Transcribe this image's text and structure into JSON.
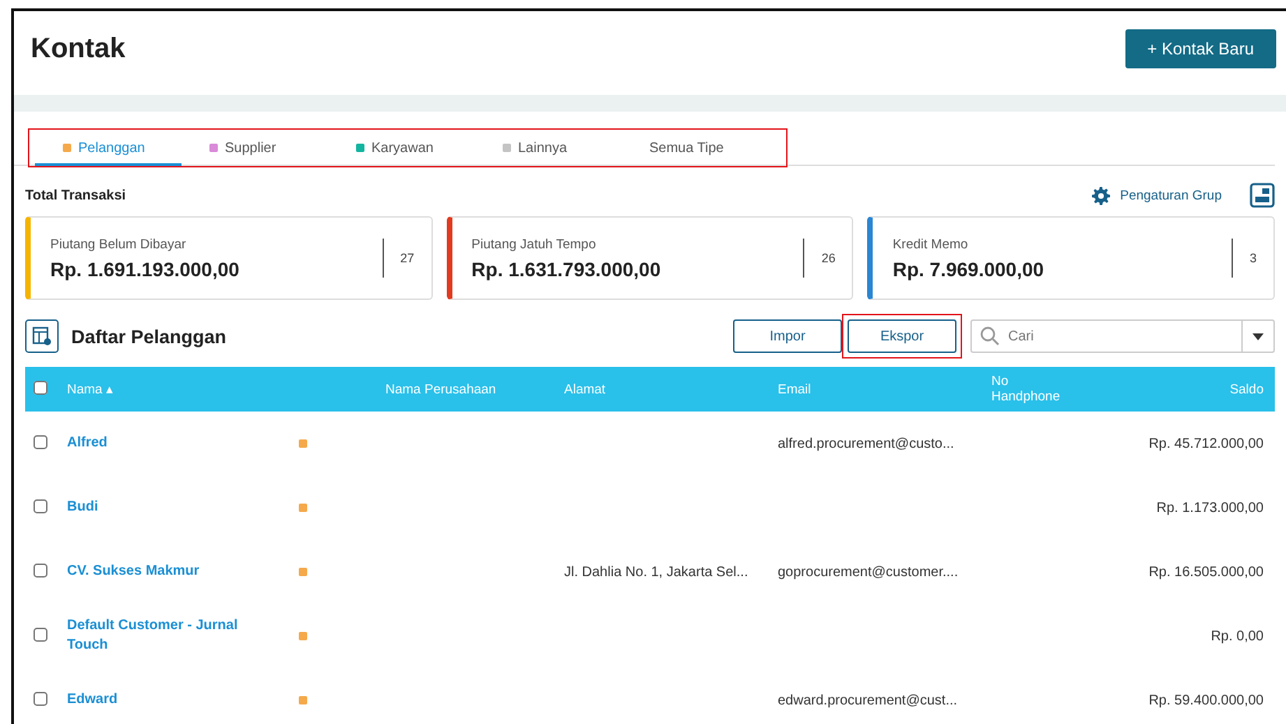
{
  "page": {
    "title": "Kontak",
    "new_button": "+ Kontak Baru"
  },
  "tabs": {
    "highlighted": true,
    "items": [
      {
        "label": "Pelanggan",
        "color": "#f5a94b",
        "selected": true
      },
      {
        "label": "Supplier",
        "color": "#d98ad8",
        "selected": false
      },
      {
        "label": "Karyawan",
        "color": "#13b5a0",
        "selected": false
      },
      {
        "label": "Lainnya",
        "color": "#c4c4c4",
        "selected": false
      },
      {
        "label": "Semua Tipe",
        "selected": false
      }
    ]
  },
  "summary": {
    "title": "Total Transaksi",
    "group_settings": "Pengaturan Grup",
    "cards": [
      {
        "label": "Piutang Belum Dibayar",
        "amount": "Rp. 1.691.193.000,00",
        "count": "27",
        "color": "#f5b400"
      },
      {
        "label": "Piutang Jatuh Tempo",
        "amount": "Rp. 1.631.793.000,00",
        "count": "26",
        "color": "#e23a1e"
      },
      {
        "label": "Kredit Memo",
        "amount": "Rp. 7.969.000,00",
        "count": "3",
        "color": "#2a85d2"
      }
    ]
  },
  "list": {
    "title": "Daftar Pelanggan",
    "buttons": [
      {
        "label": "Impor",
        "highlighted": false
      },
      {
        "label": "Ekspor",
        "highlighted": true
      }
    ],
    "search": {
      "placeholder": "Cari"
    }
  },
  "table": {
    "select_all": false,
    "columns": [
      "Nama ▴",
      "Nama Perusahaan",
      "Alamat",
      "Email",
      "No Handphone",
      "Saldo"
    ],
    "rows": [
      {
        "checked": false,
        "name": "Alfred",
        "color": "#f5a94b",
        "company": "",
        "address": "",
        "email": "alfred.procurement@custo...",
        "phone": "",
        "balance": "Rp. 45.712.000,00"
      },
      {
        "checked": false,
        "name": "Budi",
        "color": "#f5a94b",
        "company": "",
        "address": "",
        "email": "",
        "phone": "",
        "balance": "Rp. 1.173.000,00"
      },
      {
        "checked": false,
        "name": "CV. Sukses Makmur",
        "color": "#f5a94b",
        "company": "",
        "address": "Jl. Dahlia No. 1, Jakarta Sel...",
        "email": "goprocurement@customer....",
        "phone": "",
        "balance": "Rp. 16.505.000,00"
      },
      {
        "checked": false,
        "name": "Default Customer - Jurnal Touch",
        "color": "#f5a94b",
        "company": "",
        "address": "",
        "email": "",
        "phone": "",
        "balance": "Rp. 0,00"
      },
      {
        "checked": false,
        "name": "Edward",
        "color": "#f5a94b",
        "company": "",
        "address": "",
        "email": "edward.procurement@cust...",
        "phone": "",
        "balance": "Rp. 59.400.000,00"
      }
    ]
  }
}
